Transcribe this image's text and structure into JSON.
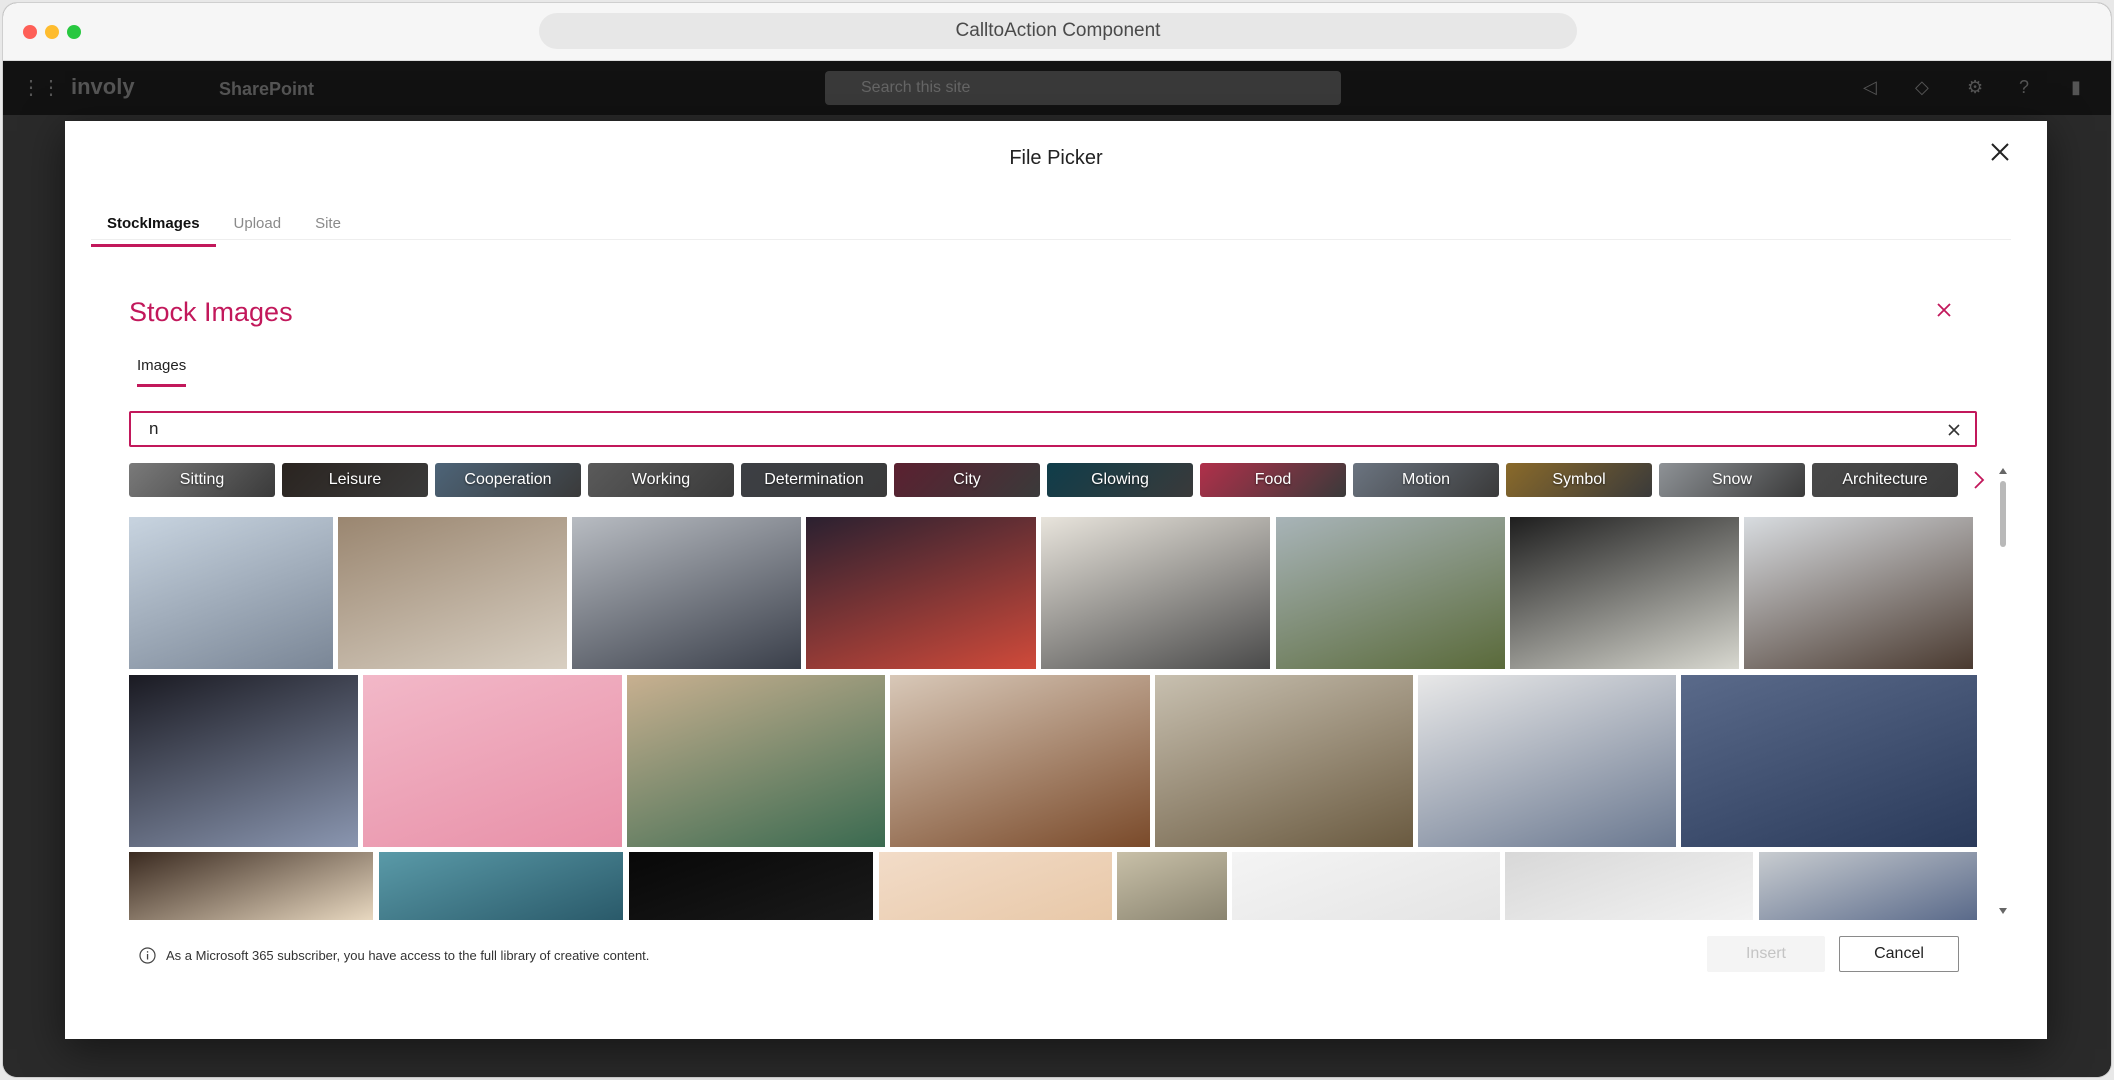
{
  "window": {
    "title": "CalltoAction Component"
  },
  "sharepoint": {
    "logo": "involy",
    "app_name": "SharePoint",
    "search_placeholder": "Search this site"
  },
  "modal": {
    "title": "File Picker",
    "tabs": [
      {
        "label": "StockImages",
        "active": true
      },
      {
        "label": "Upload",
        "active": false
      },
      {
        "label": "Site",
        "active": false
      }
    ],
    "stock": {
      "heading": "Stock Images",
      "subtab": "Images",
      "search_value": "n",
      "chips": [
        {
          "label": "Sitting",
          "color": "#7a7a7a"
        },
        {
          "label": "Leisure",
          "color": "#2a2420"
        },
        {
          "label": "Cooperation",
          "color": "#4d6478"
        },
        {
          "label": "Working",
          "color": "#5a5a5a"
        },
        {
          "label": "Determination",
          "color": "#3c3f44"
        },
        {
          "label": "City",
          "color": "#5b2030"
        },
        {
          "label": "Glowing",
          "color": "#0f3d4a"
        },
        {
          "label": "Food",
          "color": "#b0304a"
        },
        {
          "label": "Motion",
          "color": "#6b7480"
        },
        {
          "label": "Symbol",
          "color": "#8a6a2a"
        },
        {
          "label": "Snow",
          "color": "#8e9296"
        },
        {
          "label": "Architecture",
          "color": "#4a4a4a"
        }
      ]
    },
    "info_text": "As a Microsoft 365 subscriber, you have access to the full library of creative content.",
    "insert_label": "Insert",
    "cancel_label": "Cancel"
  },
  "colors": {
    "accent": "#c2185b"
  }
}
